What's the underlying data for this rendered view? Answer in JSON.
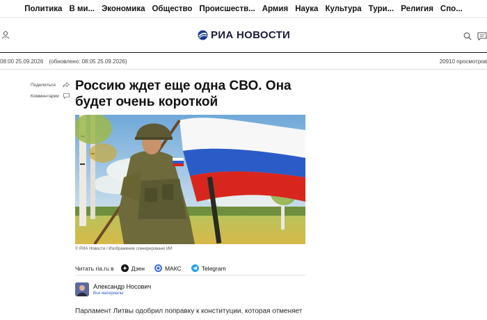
{
  "nav": {
    "items": [
      "Политика",
      "В ми...",
      "Экономика",
      "Общество",
      "Происшеств...",
      "Армия",
      "Наука",
      "Культура",
      "Тури...",
      "Религия",
      "Спо..."
    ]
  },
  "header": {
    "logo_text": "РИА НОВОСТИ",
    "icons": [
      "user-icon",
      "search-icon",
      "comments-icon"
    ]
  },
  "meta": {
    "published": "08:00 25.09.2026",
    "updated": "(обновлено: 08:05 25.09.2026)",
    "views": "20910 просмотров"
  },
  "share": {
    "share_label": "Поделиться",
    "comments_label": "Комментарии"
  },
  "article": {
    "title": "Россию ждет еще одна СВО. Она будет очень короткой",
    "photo_caption": "© РИА Новости / Изображение сгенерировано ИИ",
    "read_label": "Читать ria.ru в",
    "channels": [
      "Дзен",
      "МАКС",
      "Telegram"
    ],
    "author_name": "Александр Носович",
    "author_link": "Все материалы",
    "lead": "Парламент Литвы одобрил поправку к конституции, которая отменяет запрет"
  },
  "colors": {
    "dzen": "#111111",
    "max": "#3f6fd8",
    "telegram": "#2aa5e0",
    "logo_blue": "#1b3b8c"
  }
}
